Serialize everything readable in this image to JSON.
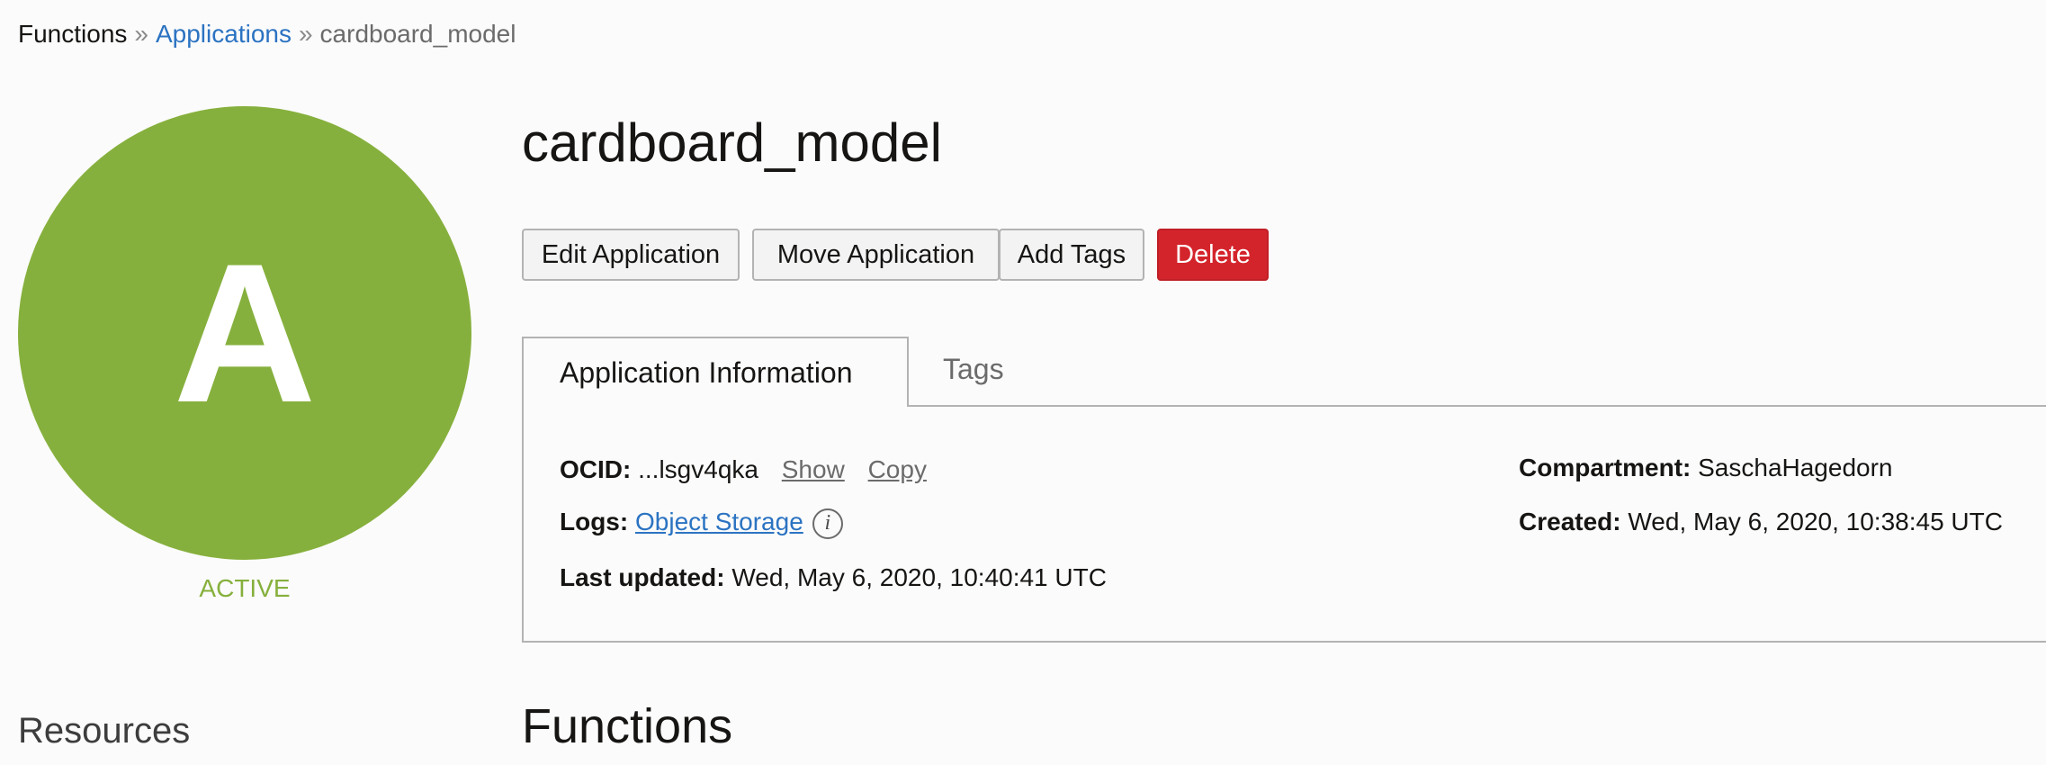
{
  "breadcrumb": {
    "root": "Functions",
    "separator": "»",
    "parent": "Applications",
    "current": "cardboard_model"
  },
  "avatar": {
    "letter": "A",
    "color": "#86b03d"
  },
  "status": "ACTIVE",
  "title": "cardboard_model",
  "actions": {
    "edit": "Edit Application",
    "move": "Move Application",
    "add_tags": "Add Tags",
    "delete": "Delete"
  },
  "tabs": {
    "info": "Application Information",
    "tags": "Tags"
  },
  "info": {
    "ocid_label": "OCID:",
    "ocid_value": "...lsgv4qka",
    "show": "Show",
    "copy": "Copy",
    "logs_label": "Logs:",
    "logs_value": "Object Storage",
    "info_icon": "i",
    "last_updated_label": "Last updated:",
    "last_updated_value": "Wed, May 6, 2020, 10:40:41 UTC",
    "compartment_label": "Compartment:",
    "compartment_value": "SaschaHagedorn",
    "created_label": "Created:",
    "created_value": "Wed, May 6, 2020, 10:38:45 UTC"
  },
  "resources_heading": "Resources",
  "functions_heading": "Functions",
  "colors": {
    "accent_link": "#2b73c2",
    "delete": "#d4242b",
    "active": "#86b03d"
  }
}
